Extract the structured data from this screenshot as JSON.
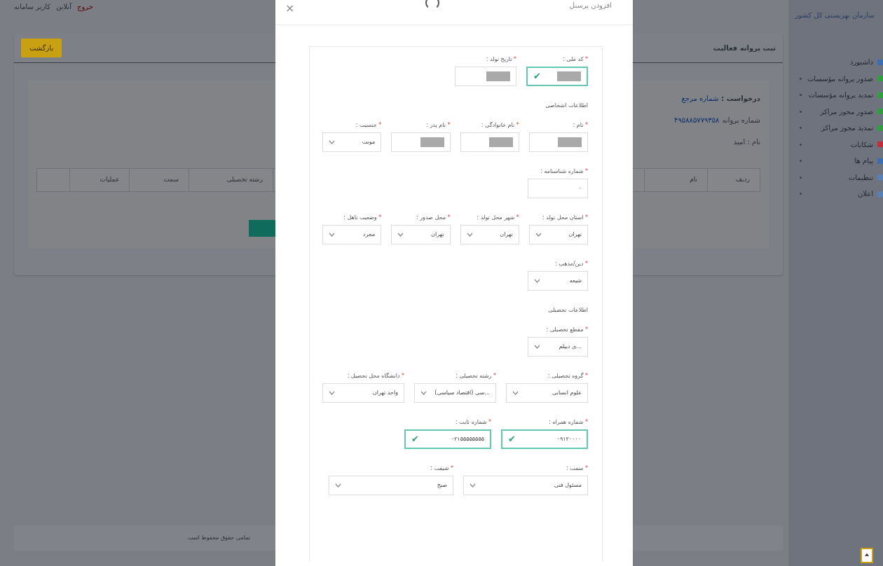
{
  "top_bar": {
    "user": "کاربر سامانه",
    "status": "آنلاین",
    "logout": "خروج"
  },
  "sidebar": {
    "title": "سازمان بهزیستی کل کشور",
    "items": [
      {
        "label": "داشبورد",
        "color": "#3d6fb0",
        "bullet": false
      },
      {
        "label": "صدور پروانه مؤسسات",
        "color": "#2e9e3e",
        "bullet": true
      },
      {
        "label": "تمدید پروانه مؤسسات",
        "color": "#2e9e3e",
        "bullet": true
      },
      {
        "label": "صدور مجوز مراکز",
        "color": "#2e9e3e",
        "bullet": true
      },
      {
        "label": "تمدید مجوز مراکز",
        "color": "#2e9e3e",
        "bullet": true
      },
      {
        "label": "شکایات",
        "color": "#c0303a",
        "bullet": true
      },
      {
        "label": "پیام ها",
        "color": "#3d6fb0",
        "bullet": true
      },
      {
        "label": "تنظیمات",
        "color": "#5a7fb5",
        "bullet": true
      },
      {
        "label": "اعلان",
        "color": "#5a7fb5",
        "bullet": true
      }
    ]
  },
  "panel": {
    "title": "ثبت پروانه فعالیت",
    "back_button": "بازگشت",
    "request_label": "درخواست :",
    "request_value": "شماره مرجع",
    "license_label": "شماره پروانه",
    "license_value": "۴۹۵۸۸۵۷۷۹۳۵۸",
    "name_label": "نام : امید",
    "table": {
      "columns": [
        "ردیف",
        "نام",
        "",
        "رشته تحصیلی",
        "سمت",
        "عملیات"
      ]
    }
  },
  "footer": "تمامی حقوق محفوظ است",
  "modal": {
    "title": "افزودن پرسنل",
    "close": "×",
    "sections": [
      {
        "rows": [
          [
            {
              "mark": "*",
              "label": "کد ملی :",
              "kind": "input",
              "valid": true,
              "check": "✔",
              "redacted": true
            },
            {
              "mark": "*",
              "label": "تاریخ تولد :",
              "kind": "input",
              "valid": false,
              "redacted": true
            }
          ]
        ]
      },
      {
        "heading": "اطلاعات اشخاصی",
        "rows": [
          [
            {
              "mark": "*",
              "label": "نام :",
              "kind": "input",
              "valid": false,
              "redacted": true
            },
            {
              "mark": "*",
              "label": "نام خانوادگی :",
              "kind": "input",
              "valid": false,
              "redacted": true
            },
            {
              "mark": "*",
              "label": "نام پدر :",
              "kind": "input",
              "valid": false,
              "redacted": true
            },
            {
              "mark": "*",
              "label": "جنسیت :",
              "kind": "select",
              "value": "مونث",
              "valid": false
            }
          ],
          [
            {
              "mark": "*",
              "label": "شماره شناسنامه :",
              "kind": "input",
              "value": "۰",
              "valid": false
            }
          ],
          [
            {
              "mark": "*",
              "label": "استان محل تولد :",
              "kind": "select",
              "value": "تهران",
              "valid": false
            },
            {
              "mark": "*",
              "label": "شهر محل تولد :",
              "kind": "select",
              "value": "تهران",
              "valid": false
            },
            {
              "mark": "*",
              "label": "محل صدور :",
              "kind": "select",
              "value": "تهران",
              "valid": false
            },
            {
              "mark": "*",
              "label": "وضعیت تاهل :",
              "kind": "select",
              "value": "مجرد",
              "valid": false
            }
          ],
          [
            {
              "mark": "*",
              "label": "دین/مذهب :",
              "kind": "select",
              "value": "شیعه",
              "valid": false
            }
          ]
        ]
      },
      {
        "heading": "اطلاعات تحصیلی",
        "rows": [
          [
            {
              "mark": "*",
              "label": "مقطع تحصیلی :",
              "kind": "select",
              "value": "...ی دیپلم",
              "valid": false
            }
          ],
          [
            {
              "mark": "*",
              "label": "گروه تحصیلی :",
              "kind": "select",
              "value": "علوم انسانی",
              "valid": false
            },
            {
              "mark": "*",
              "label": "رشته تحصیلی :",
              "kind": "select",
              "value": "...سی (اقتصاد سیاسی)",
              "valid": false
            },
            {
              "mark": "*",
              "label": "دانشگاه محل تحصیل :",
              "kind": "select",
              "value": "واحد تهران",
              "valid": false
            }
          ],
          [
            {
              "mark": "*",
              "label": "شماره همراه :",
              "kind": "input",
              "value": "۰۹۱۲۰۰۰۰",
              "valid": true,
              "check": "✔"
            },
            {
              "mark": "*",
              "label": "شماره ثابت :",
              "kind": "input",
              "value": "۰۲۱۵۵۵۵۵۵۵۵",
              "valid": true,
              "check": "✔"
            }
          ],
          [
            {
              "mark": "*",
              "label": "سمت :",
              "kind": "select",
              "value": "مسئول فنی",
              "valid": false
            },
            {
              "mark": "*",
              "label": "شیفت :",
              "kind": "select",
              "value": "صبح",
              "valid": false
            }
          ]
        ]
      }
    ]
  }
}
